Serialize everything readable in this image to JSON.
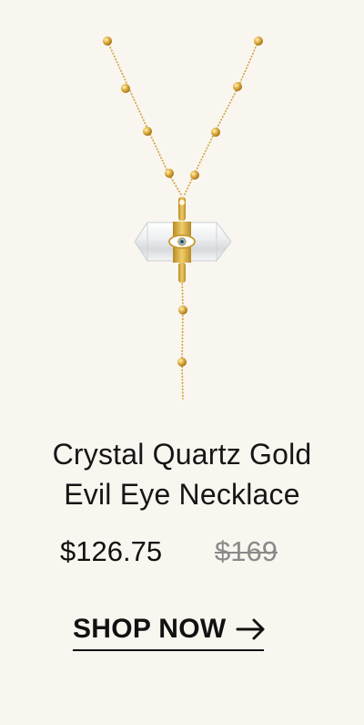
{
  "product": {
    "title_line1": "Crystal Quartz Gold",
    "title_line2": "Evil Eye Necklace",
    "price_current": "$126.75",
    "price_original": "$169",
    "image_icon": "necklace-crystal-pendant"
  },
  "cta": {
    "label": "SHOP NOW",
    "icon": "arrow-right-icon"
  },
  "colors": {
    "background": "#f9f6f0",
    "gold": "#d9a93a",
    "strike_price": "#8a8a8a",
    "text": "#111111"
  }
}
